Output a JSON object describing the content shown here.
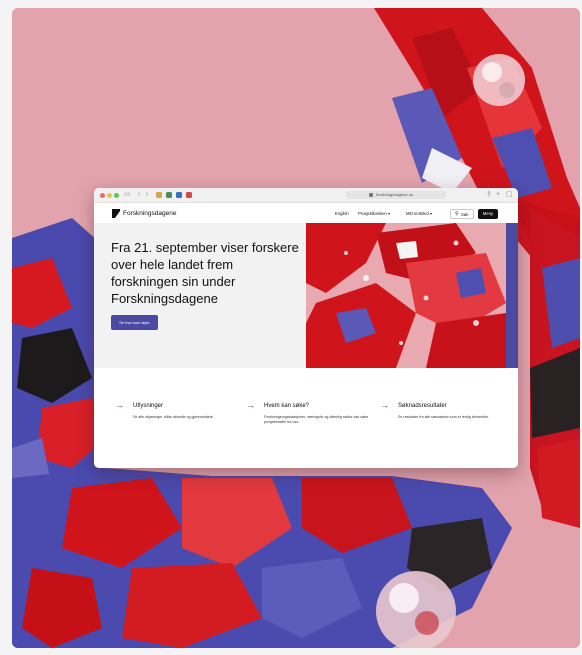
{
  "colors": {
    "accent": "#4a4aa3",
    "pink_background": "#e2a3ad",
    "ribbon_red": "#d0141c",
    "ribbon_blue": "#4e4fb0",
    "menu_button": "#111111"
  },
  "browser": {
    "url": "forskningsdagene.no"
  },
  "site": {
    "logo": "Forskningsdagene",
    "nav": {
      "language": "English",
      "projects": "Prosjektbanken ▾",
      "my_site": "Mitt nettsted ▾",
      "search": "Søk",
      "menu": "Meny"
    }
  },
  "hero": {
    "title": "Fra 21. september viser forskere over hele landet frem forskningen sin under Forskningsdagene",
    "cta": "Se hva som skjer"
  },
  "cards": [
    {
      "title": "Utlysninger",
      "description": "Se alle utlysninger, både aktuelle og gjennomførte."
    },
    {
      "title": "Hvem kan søke?",
      "description": "Forskningsorganisasjoner, næringsliv og offentlig sektor kan søke prosjektmidler fra oss."
    },
    {
      "title": "Søknadsresultater",
      "description": "Se resultater fra alle søknadene som er ferdig behandlet."
    }
  ],
  "icons": [
    "arrow-right-icon",
    "search-icon",
    "lock-icon",
    "logo-icon",
    "back-icon",
    "forward-icon",
    "sidebar-icon",
    "share-icon",
    "new-tab-icon",
    "tabs-icon"
  ]
}
